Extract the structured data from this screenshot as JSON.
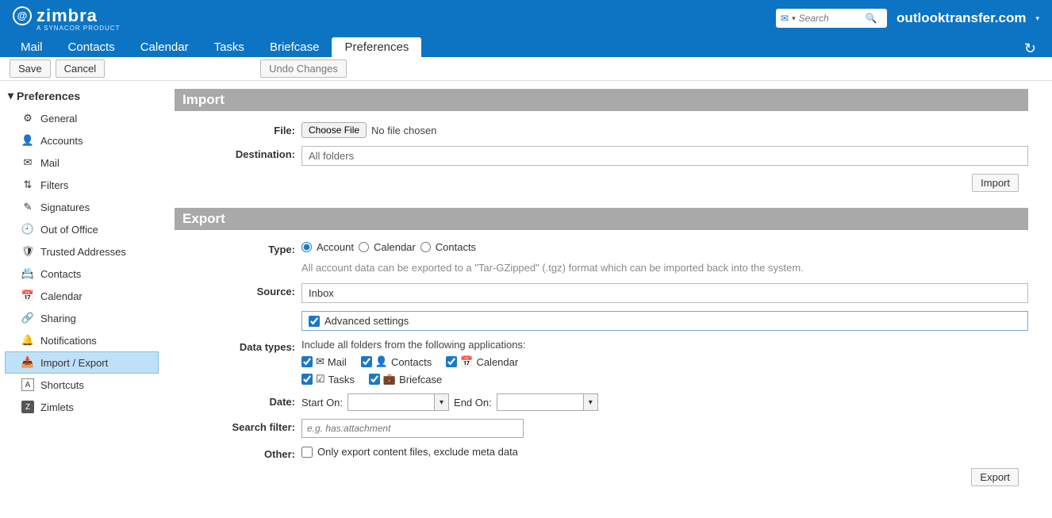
{
  "brand": "outlooktransfer.com",
  "logo_text": "zimbra",
  "logo_sub": "A SYNACOR PRODUCT",
  "search_placeholder": "Search",
  "nav": {
    "mail": "Mail",
    "contacts": "Contacts",
    "calendar": "Calendar",
    "tasks": "Tasks",
    "briefcase": "Briefcase",
    "preferences": "Preferences"
  },
  "toolbar": {
    "save": "Save",
    "cancel": "Cancel",
    "undo": "Undo Changes"
  },
  "sidebar": {
    "header": "Preferences",
    "items": [
      {
        "label": "General",
        "icon": "⚙"
      },
      {
        "label": "Accounts",
        "icon": "👤"
      },
      {
        "label": "Mail",
        "icon": "✉"
      },
      {
        "label": "Filters",
        "icon": "⇅"
      },
      {
        "label": "Signatures",
        "icon": "✎"
      },
      {
        "label": "Out of Office",
        "icon": "🕘"
      },
      {
        "label": "Trusted Addresses",
        "icon": "🛡"
      },
      {
        "label": "Contacts",
        "icon": "📇"
      },
      {
        "label": "Calendar",
        "icon": "📅"
      },
      {
        "label": "Sharing",
        "icon": "🔗"
      },
      {
        "label": "Notifications",
        "icon": "🔔"
      },
      {
        "label": "Import / Export",
        "icon": "📥"
      },
      {
        "label": "Shortcuts",
        "icon": "A"
      },
      {
        "label": "Zimlets",
        "icon": "Z"
      }
    ]
  },
  "import": {
    "header": "Import",
    "file_label": "File:",
    "choose_file": "Choose File",
    "no_file": "No file chosen",
    "destination_label": "Destination:",
    "destination_value": "All folders",
    "button": "Import"
  },
  "export": {
    "header": "Export",
    "type_label": "Type:",
    "type_options": {
      "account": "Account",
      "calendar": "Calendar",
      "contacts": "Contacts"
    },
    "type_hint": "All account data can be exported to a \"Tar-GZipped\" (.tgz) format which can be imported back into the system.",
    "source_label": "Source:",
    "source_value": "Inbox",
    "advanced_label": "Advanced settings",
    "data_types_label": "Data types:",
    "data_types_hint": "Include all folders from the following applications:",
    "dt": {
      "mail": "Mail",
      "contacts": "Contacts",
      "calendar": "Calendar",
      "tasks": "Tasks",
      "briefcase": "Briefcase"
    },
    "date_label": "Date:",
    "start_on": "Start On:",
    "end_on": "End On:",
    "search_label": "Search filter:",
    "search_placeholder": "e.g. has:attachment",
    "other_label": "Other:",
    "other_option": "Only export content files, exclude meta data",
    "button": "Export"
  }
}
